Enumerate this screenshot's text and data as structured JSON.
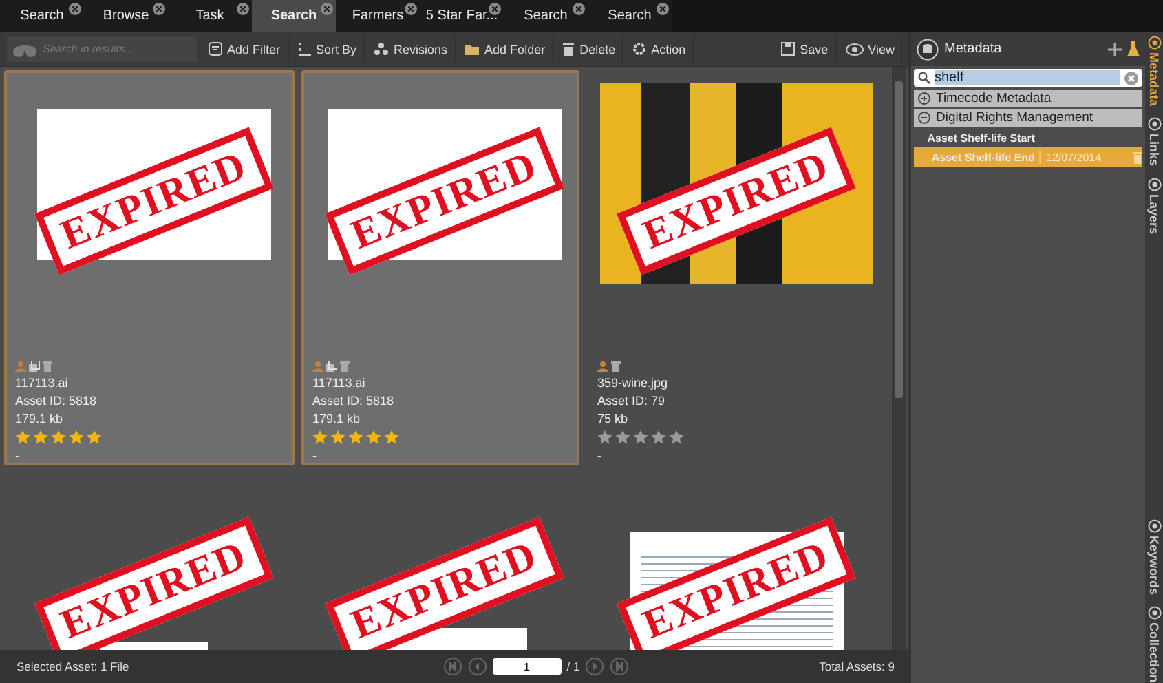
{
  "tabs": [
    {
      "label": "Search",
      "selected": false
    },
    {
      "label": "Browse",
      "selected": false
    },
    {
      "label": "Task",
      "selected": false
    },
    {
      "label": "Search",
      "selected": true
    },
    {
      "label": "Farmers",
      "selected": false
    },
    {
      "label": "5 Star Far...",
      "selected": false
    },
    {
      "label": "Search",
      "selected": false
    },
    {
      "label": "Search",
      "selected": false
    }
  ],
  "toolbar": {
    "search": {
      "placeholder": "Search in results..."
    },
    "actions": [
      {
        "kind": "filter",
        "label": "Add Filter"
      },
      {
        "kind": "sort",
        "label": "Sort By"
      },
      {
        "kind": "revisions",
        "label": "Revisions"
      },
      {
        "kind": "folder",
        "label": "Add Folder"
      },
      {
        "kind": "delete",
        "label": "Delete"
      },
      {
        "kind": "action",
        "label": "Action"
      }
    ],
    "right_actions": [
      {
        "kind": "save",
        "label": "Save"
      },
      {
        "kind": "view",
        "label": "View"
      }
    ]
  },
  "assets": [
    {
      "kind": "graphic",
      "stamp": "EXPIRED",
      "selected": true,
      "linked": true,
      "name": "117113.ai",
      "asset_id": "Asset ID: 5818",
      "size": "179.1 kb",
      "stars": 5,
      "note": "-"
    },
    {
      "kind": "graphic",
      "stamp": "EXPIRED",
      "selected": true,
      "linked": true,
      "name": "117113.ai",
      "asset_id": "Asset ID: 5818",
      "size": "179.1 kb",
      "stars": 5,
      "note": "-"
    },
    {
      "kind": "photo",
      "stamp": "EXPIRED",
      "selected": false,
      "linked": false,
      "name": "359-wine.jpg",
      "asset_id": "Asset ID: 79",
      "size": "75 kb",
      "stars": 0,
      "note": "-"
    },
    {
      "kind": "small",
      "stamp": "EXPIRED",
      "selected": false
    },
    {
      "kind": "sketch",
      "stamp": "EXPIRED",
      "selected": false
    },
    {
      "kind": "document",
      "stamp": "EXPIRED",
      "selected": false
    }
  ],
  "status_bar": {
    "selected": "Selected Asset: 1 File",
    "page": "1",
    "pages": "/ 1",
    "total": "Total Assets: 9"
  },
  "metadata": {
    "title": "Metadata",
    "search": "shelf",
    "groups": [
      {
        "label": "Timecode Metadata",
        "expanded": false
      },
      {
        "label": "Digital Rights Management",
        "expanded": true,
        "children": [
          {
            "label": "Asset Shelf-life Start",
            "selected": false
          },
          {
            "label": "Asset Shelf-life End",
            "value": "12/07/2014",
            "selected": true
          }
        ]
      }
    ]
  },
  "side_tabs": [
    {
      "label": "Metadata",
      "selected": true
    },
    {
      "label": "Links",
      "selected": false
    },
    {
      "label": "Layers",
      "selected": false
    },
    {
      "label": "Keywords",
      "selected": false
    },
    {
      "label": "Collection",
      "selected": false
    }
  ]
}
